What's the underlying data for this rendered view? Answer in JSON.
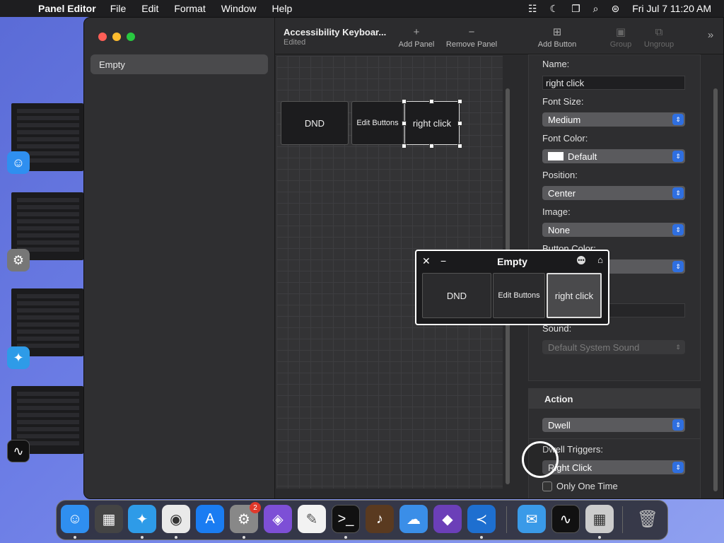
{
  "menubar": {
    "app_name": "Panel Editor",
    "items": [
      "File",
      "Edit",
      "Format",
      "Window",
      "Help"
    ],
    "clock": "Fri Jul 7  11:20 AM"
  },
  "sidebar": {
    "items": [
      {
        "label": "Empty"
      }
    ]
  },
  "toolbar": {
    "title": "Accessibility Keyboar...",
    "subtitle": "Edited",
    "add_panel": "Add Panel",
    "remove_panel": "Remove Panel",
    "add_button": "Add Button",
    "group": "Group",
    "ungroup": "Ungroup"
  },
  "canvas": {
    "buttons": [
      {
        "label": "DND"
      },
      {
        "label": "Edit Buttons"
      },
      {
        "label": "right click"
      }
    ]
  },
  "inspector": {
    "name_label": "Name:",
    "name_value": "right click",
    "font_size_label": "Font Size:",
    "font_size_value": "Medium",
    "font_color_label": "Font Color:",
    "font_color_value": "Default",
    "position_label": "Position:",
    "position_value": "Center",
    "image_label": "Image:",
    "image_value": "None",
    "button_color_label": "Button Color:",
    "sound_label": "Sound:",
    "sound_value": "Default System Sound",
    "action_header": "Action",
    "action_value": "Dwell",
    "dwell_triggers_label": "Dwell Triggers:",
    "dwell_triggers_value": "Right Click",
    "only_one_time_label": "Only One Time"
  },
  "floating_panel": {
    "title": "Empty",
    "buttons": [
      {
        "label": "DND"
      },
      {
        "label": "Edit Buttons"
      },
      {
        "label": "right click"
      }
    ]
  },
  "dock": {
    "system_settings_badge": "2"
  },
  "colors": {
    "accent": "#2f6fe0",
    "close": "#ff5f57",
    "minimize": "#febc2e",
    "zoom": "#28c840"
  }
}
